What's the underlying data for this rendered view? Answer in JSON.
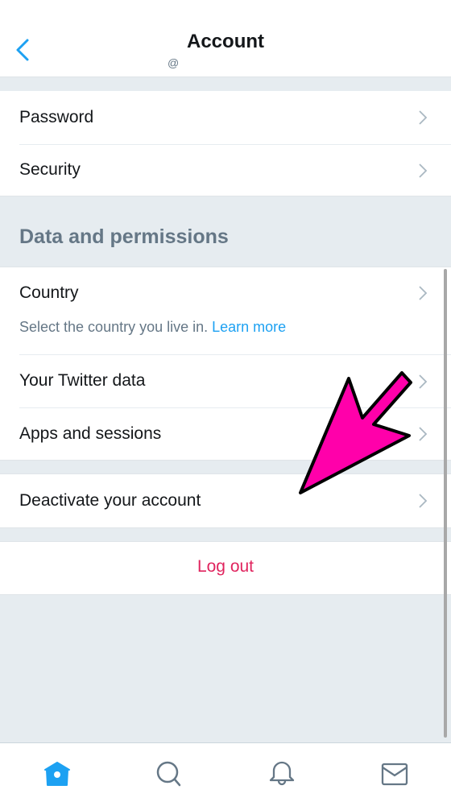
{
  "header": {
    "title": "Account",
    "subtitle": "@",
    "back_icon": "chevron-left-icon"
  },
  "groups": {
    "top": [
      {
        "label": "Password"
      },
      {
        "label": "Security"
      }
    ],
    "section_title": "Data and permissions",
    "country": {
      "label": "Country",
      "description": "Select the country you live in. ",
      "link": "Learn more"
    },
    "data_items": [
      {
        "label": "Your Twitter data"
      },
      {
        "label": "Apps and sessions"
      }
    ],
    "deactivate": {
      "label": "Deactivate your account"
    },
    "logout": {
      "label": "Log out"
    }
  },
  "tabbar": {
    "tabs": [
      {
        "name": "home",
        "icon": "home-icon",
        "active": true
      },
      {
        "name": "search",
        "icon": "search-icon",
        "active": false
      },
      {
        "name": "notifications",
        "icon": "bell-icon",
        "active": false
      },
      {
        "name": "messages",
        "icon": "mail-icon",
        "active": false
      }
    ]
  },
  "colors": {
    "accent": "#1da1f2",
    "danger": "#e0245e",
    "annotation_arrow": "#ff00aa",
    "background": "#e6ecf0"
  }
}
